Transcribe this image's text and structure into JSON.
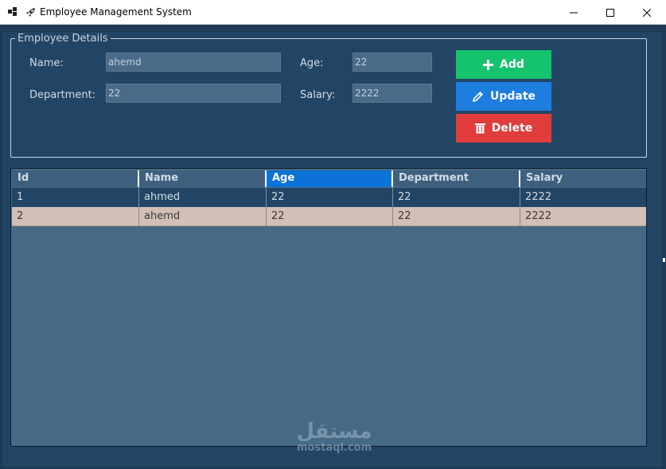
{
  "window": {
    "title": "Employee Management System",
    "colors": {
      "background": "#1e3a56",
      "panel": "#234565",
      "table_bg": "#466a85"
    }
  },
  "details": {
    "legend": "Employee Details",
    "name_label": "Name:",
    "name_value": "ahemd",
    "age_label": "Age:",
    "age_value": "22",
    "department_label": "Department:",
    "department_value": "22",
    "salary_label": "Salary:",
    "salary_value": "2222"
  },
  "buttons": {
    "add": {
      "label": "Add",
      "icon": "plus-icon",
      "color": "#14c36b"
    },
    "update": {
      "label": "Update",
      "icon": "pencil-icon",
      "color": "#1d7ee0"
    },
    "delete": {
      "label": "Delete",
      "icon": "trash-icon",
      "color": "#e03c3c"
    }
  },
  "table": {
    "columns": [
      "Id",
      "Name",
      "Age",
      "Department",
      "Salary"
    ],
    "active_column": "Age",
    "rows": [
      [
        "1",
        "ahmed",
        "22",
        "22",
        "2222"
      ],
      [
        "2",
        "ahemd",
        "22",
        "22",
        "2222"
      ]
    ],
    "selected_row": 2
  },
  "watermark": {
    "arabic": "مستقل",
    "latin": "mostaql.com"
  }
}
